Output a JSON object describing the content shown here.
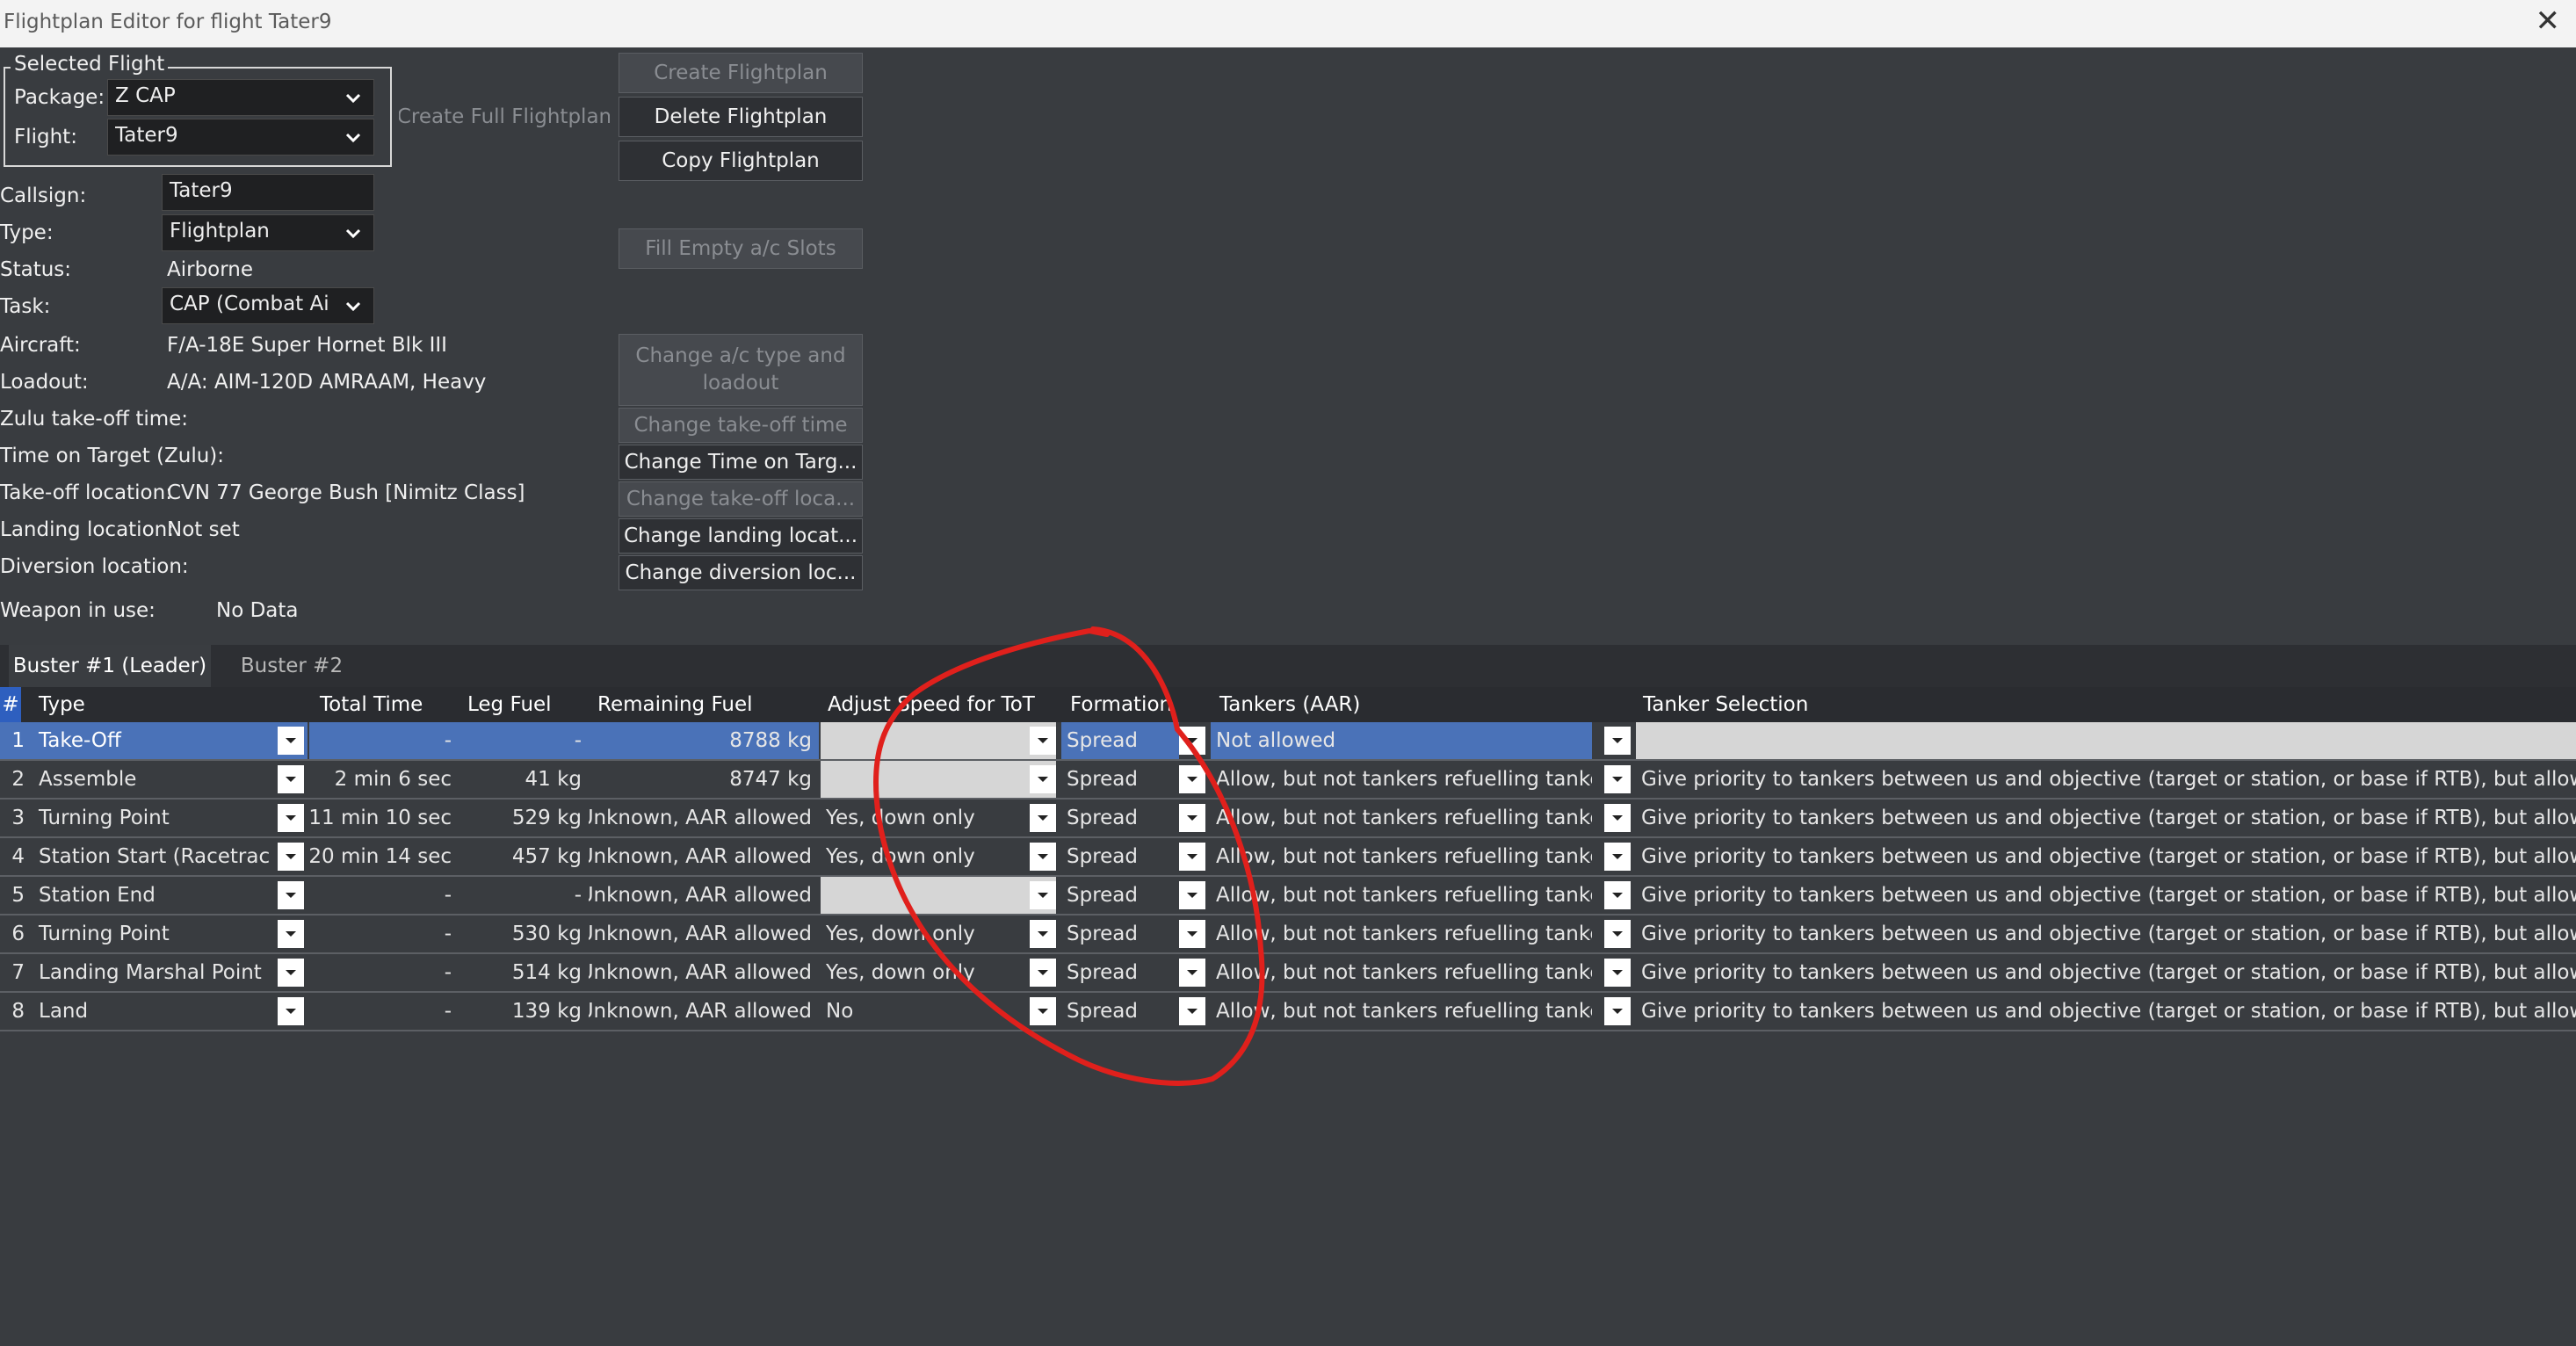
{
  "window": {
    "title": "Flightplan Editor for flight Tater9",
    "close_glyph": "✕"
  },
  "selected_flight": {
    "group_title": "Selected Flight",
    "package_label": "Package:",
    "package_value": "Z CAP",
    "flight_label": "Flight:",
    "flight_value": "Tater9"
  },
  "details": {
    "callsign_label": "Callsign:",
    "callsign_value": "Tater9",
    "type_label": "Type:",
    "type_value": "Flightplan",
    "status_label": "Status:",
    "status_value": "Airborne",
    "task_label": "Task:",
    "task_value": "CAP (Combat Ai",
    "aircraft_label": "Aircraft:",
    "aircraft_value": "F/A-18E Super Hornet Blk III",
    "loadout_label": "Loadout:",
    "loadout_value": "A/A: AIM-120D AMRAAM, Heavy",
    "zulu_takeoff_label": "Zulu take-off time:",
    "tot_label": "Time on Target (Zulu):",
    "takeoff_loc_label": "Take-off location:",
    "takeoff_loc_value": "CVN 77 George Bush [Nimitz Class]",
    "landing_loc_label": "Landing location:",
    "landing_loc_value": "Not set",
    "diversion_loc_label": "Diversion location:",
    "weapon_label": "Weapon in use:",
    "weapon_value": "No Data"
  },
  "buttons": {
    "create_full": "Create Full Flightplan",
    "create": "Create Flightplan",
    "delete": "Delete Flightplan",
    "copy": "Copy Flightplan",
    "fill_empty": "Fill Empty a/c Slots",
    "change_ac": "Change a/c type and loadout",
    "change_takeoff_time": "Change take-off time",
    "change_tot": "Change Time on Targ...",
    "change_takeoff_loc": "Change take-off loca...",
    "change_landing_loc": "Change landing locat...",
    "change_diversion_loc": "Change diversion loc..."
  },
  "tabs": [
    {
      "label": "Buster #1 (Leader)",
      "active": true
    },
    {
      "label": "Buster #2",
      "active": false
    }
  ],
  "table": {
    "headers": [
      "#",
      "Type",
      "Total Time",
      "Leg Fuel",
      "Remaining Fuel",
      "Adjust Speed for ToT",
      "Formation",
      "Tankers (AAR)",
      "Tanker Selection"
    ],
    "rows": [
      {
        "n": "1",
        "type": "Take-Off",
        "total_time": "-",
        "leg_fuel": "-",
        "remaining_fuel": "8788 kg",
        "adjust_speed": "",
        "formation": "Spread",
        "tankers": "Not allowed",
        "tanker_selection": ""
      },
      {
        "n": "2",
        "type": "Assemble",
        "total_time": "2 min 6 sec",
        "leg_fuel": "41 kg",
        "remaining_fuel": "8747 kg",
        "adjust_speed": "",
        "formation": "Spread",
        "tankers": "Allow, but not tankers refuelling tankers",
        "tanker_selection": "Give priority to tankers between us and objective (target or station, or base if RTB), but allow turning b"
      },
      {
        "n": "3",
        "type": "Turning Point",
        "total_time": "11 min 10 sec",
        "leg_fuel": "529 kg",
        "remaining_fuel": "Unknown, AAR allowed",
        "adjust_speed": "Yes, down only",
        "formation": "Spread",
        "tankers": "Allow, but not tankers refuelling tankers",
        "tanker_selection": "Give priority to tankers between us and objective (target or station, or base if RTB), but allow turning b"
      },
      {
        "n": "4",
        "type": "Station Start (Racetrack)",
        "total_time": "20 min 14 sec",
        "leg_fuel": "457 kg",
        "remaining_fuel": "Unknown, AAR allowed",
        "adjust_speed": "Yes, down only",
        "formation": "Spread",
        "tankers": "Allow, but not tankers refuelling tankers",
        "tanker_selection": "Give priority to tankers between us and objective (target or station, or base if RTB), but allow turning b"
      },
      {
        "n": "5",
        "type": "Station End",
        "total_time": "-",
        "leg_fuel": "-",
        "remaining_fuel": "Unknown, AAR allowed",
        "adjust_speed": "",
        "formation": "Spread",
        "tankers": "Allow, but not tankers refuelling tankers",
        "tanker_selection": "Give priority to tankers between us and objective (target or station, or base if RTB), but allow turning b"
      },
      {
        "n": "6",
        "type": "Turning Point",
        "total_time": "-",
        "leg_fuel": "530 kg",
        "remaining_fuel": "Unknown, AAR allowed",
        "adjust_speed": "Yes, down only",
        "formation": "Spread",
        "tankers": "Allow, but not tankers refuelling tankers",
        "tanker_selection": "Give priority to tankers between us and objective (target or station, or base if RTB), but allow turning b"
      },
      {
        "n": "7",
        "type": "Landing Marshal Point",
        "total_time": "-",
        "leg_fuel": "514 kg",
        "remaining_fuel": "Unknown, AAR allowed",
        "adjust_speed": "Yes, down only",
        "formation": "Spread",
        "tankers": "Allow, but not tankers refuelling tankers",
        "tanker_selection": "Give priority to tankers between us and objective (target or station, or base if RTB), but allow turning b"
      },
      {
        "n": "8",
        "type": "Land",
        "total_time": "-",
        "leg_fuel": "139 kg",
        "remaining_fuel": "Unknown, AAR allowed",
        "adjust_speed": "No",
        "formation": "Spread",
        "tankers": "Allow, but not tankers refuelling tankers",
        "tanker_selection": "Give priority to tankers between us and objective (target or station, or base if RTB), but allow turning b"
      }
    ]
  },
  "annotation": {
    "shape": "hand-drawn-circle",
    "color": "#e0201c"
  },
  "colors": {
    "background": "#393c40",
    "selection": "#4a72b8",
    "disabled_cell": "#d6d6d6"
  }
}
